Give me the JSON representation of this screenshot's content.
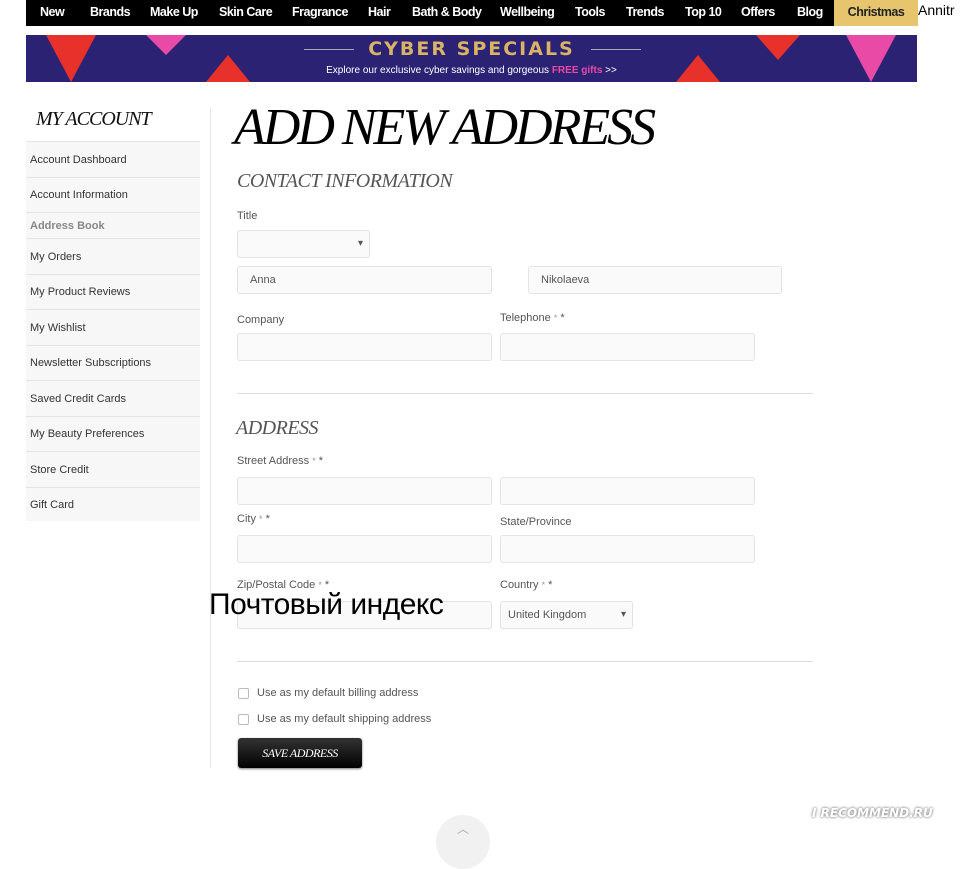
{
  "nav": {
    "items": [
      "New",
      "Brands",
      "Make Up",
      "Skin Care",
      "Fragrance",
      "Hair",
      "Bath & Body",
      "Wellbeing",
      "Tools",
      "Trends",
      "Top 10",
      "Offers",
      "Blog"
    ],
    "highlight": "Christmas",
    "user": "Annitr"
  },
  "banner": {
    "title": "CYBER SPECIALS",
    "subtitle_pre": "Explore our exclusive cyber savings and gorgeous",
    "subtitle_free": "FREE gifts",
    "subtitle_post": ">>"
  },
  "sidebar": {
    "title": "MY ACCOUNT",
    "items": [
      "Account Dashboard",
      "Account Information",
      "Address Book",
      "My Orders",
      "My Product Reviews",
      "My Wishlist",
      "Newsletter Subscriptions",
      "Saved Credit Cards",
      "My Beauty Preferences",
      "Store Credit",
      "Gift Card"
    ],
    "active": "Address Book"
  },
  "page": {
    "title": "ADD NEW ADDRESS"
  },
  "contact": {
    "heading": "CONTACT INFORMATION",
    "title_label": "Title",
    "title_value": "",
    "first_name": "Anna",
    "last_name": "Nikolaeva",
    "company_label": "Company",
    "telephone_label": "Telephone"
  },
  "address": {
    "heading": "ADDRESS",
    "street_label": "Street Address",
    "city_label": "City",
    "state_label": "State/Province",
    "zip_label": "Zip/Postal Code",
    "country_label": "Country",
    "country_value": "United Kingdom",
    "required_mark": "*",
    "required_star": " *"
  },
  "options": {
    "billing": "Use as my default billing address",
    "shipping": "Use as my default shipping address"
  },
  "save_label": "SAVE ADDRESS",
  "overlay_text": "Почтовый индекс",
  "watermark": "I RECOMMEND.RU",
  "colors": {
    "nav_bg": "#000000",
    "christmas": "#e6c56e",
    "banner_bg": "#2b2274",
    "gold": "#d9b466",
    "pink": "#e84aa5"
  }
}
